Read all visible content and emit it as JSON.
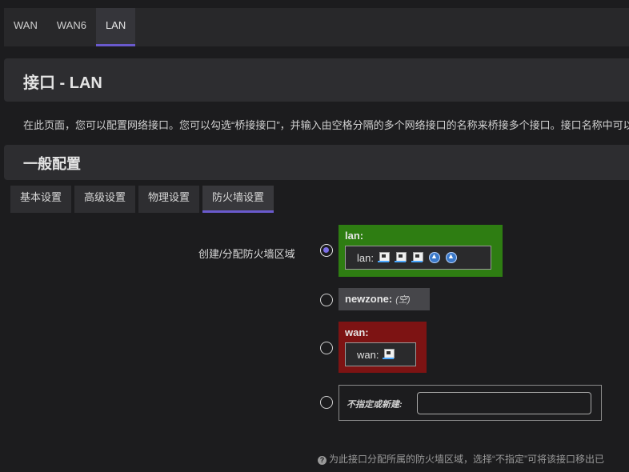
{
  "top_tabs": [
    "WAN",
    "WAN6",
    "LAN"
  ],
  "active_top_tab": "LAN",
  "page": {
    "title": "接口 - LAN",
    "description": "在此页面，您可以配置网络接口。您可以勾选“桥接接口”，并输入由空格分隔的多个网络接口的名称来桥接多个接口。接口名称中可以"
  },
  "section": {
    "title": "一般配置"
  },
  "sub_tabs": [
    "基本设置",
    "高级设置",
    "物理设置",
    "防火墙设置"
  ],
  "active_sub_tab": "防火墙设置",
  "firewall": {
    "label": "创建/分配防火墙区域",
    "zones": [
      {
        "name": "lan:",
        "inner_label": "lan:",
        "color": "#2e7d12",
        "selected": true,
        "icons": [
          "ethernet-port-icon",
          "ethernet-port-icon",
          "ethernet-port-icon",
          "wifi-icon",
          "wifi-icon"
        ]
      },
      {
        "name": "newzone:",
        "empty_text": "(空)",
        "color": "#46464a",
        "selected": false
      },
      {
        "name": "wan:",
        "inner_label": "wan:",
        "color": "#7d1313",
        "selected": false,
        "icons": [
          "ethernet-port-icon"
        ]
      }
    ],
    "unspecified_label": "不指定或新建:",
    "unspecified_value": "",
    "help": "为此接口分配所属的防火墙区域，选择“不指定”可将该接口移出已"
  },
  "colors": {
    "accent": "#6a5acd",
    "lan_zone": "#2e7d12",
    "wan_zone": "#7d1313",
    "newzone": "#46464a"
  }
}
